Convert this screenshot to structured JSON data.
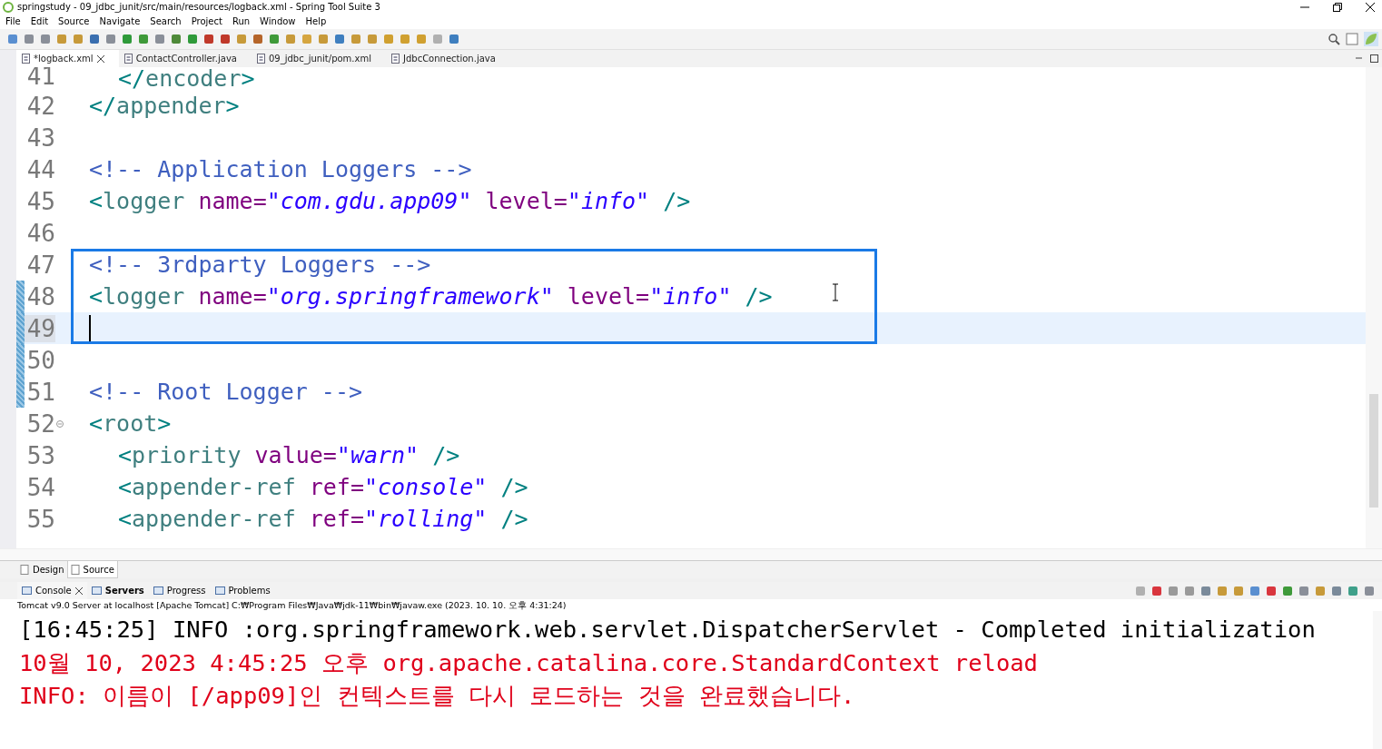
{
  "window": {
    "title": "springstudy - 09_jdbc_junit/src/main/resources/logback.xml - Spring Tool Suite 3"
  },
  "menu": [
    "File",
    "Edit",
    "Source",
    "Navigate",
    "Search",
    "Project",
    "Run",
    "Window",
    "Help"
  ],
  "editor_tabs": [
    {
      "label": "*logback.xml",
      "selected": true
    },
    {
      "label": "ContactController.java",
      "selected": false
    },
    {
      "label": "09_jdbc_junit/pom.xml",
      "selected": false
    },
    {
      "label": "JdbcConnection.java",
      "selected": false
    }
  ],
  "code_lines": [
    {
      "number": "41",
      "indented": true,
      "tokens": [
        {
          "kind": "punct",
          "text": "</"
        },
        {
          "kind": "tag",
          "text": "encoder"
        },
        {
          "kind": "punct",
          "text": ">"
        }
      ]
    },
    {
      "number": "42",
      "tokens": [
        {
          "kind": "punct",
          "text": "</"
        },
        {
          "kind": "tag",
          "text": "appender"
        },
        {
          "kind": "punct",
          "text": ">"
        }
      ]
    },
    {
      "number": "43"
    },
    {
      "number": "44",
      "tokens": [
        {
          "kind": "comment",
          "text": "<!-- Application Loggers -->"
        }
      ]
    },
    {
      "number": "45",
      "tokens": [
        {
          "kind": "punct",
          "text": "<"
        },
        {
          "kind": "tag",
          "text": "logger"
        },
        {
          "kind": "attr",
          "text": " name="
        },
        {
          "kind": "value",
          "text": "\"com.gdu.app09\""
        },
        {
          "kind": "attr",
          "text": " level="
        },
        {
          "kind": "value",
          "text": "\"info\""
        },
        {
          "kind": "punct",
          "text": " />"
        }
      ]
    },
    {
      "number": "46"
    },
    {
      "number": "47",
      "boxed": true,
      "tokens": [
        {
          "kind": "comment",
          "text": "<!-- 3rdparty Loggers -->"
        }
      ]
    },
    {
      "number": "48",
      "boxed": true,
      "changed": true,
      "tokens": [
        {
          "kind": "punct",
          "text": "<"
        },
        {
          "kind": "tag",
          "text": "logger"
        },
        {
          "kind": "attr",
          "text": " name="
        },
        {
          "kind": "value",
          "text": "\"org.springframework\""
        },
        {
          "kind": "attr",
          "text": " level="
        },
        {
          "kind": "value",
          "text": "\"info\""
        },
        {
          "kind": "punct",
          "text": " />"
        }
      ]
    },
    {
      "number": "49",
      "boxed": true,
      "current": true,
      "changed": true
    },
    {
      "number": "50",
      "changed": true
    },
    {
      "number": "51",
      "changed": true,
      "tokens": [
        {
          "kind": "comment",
          "text": "<!-- Root Logger -->"
        }
      ]
    },
    {
      "number": "52",
      "foldable": true,
      "tokens": [
        {
          "kind": "punct",
          "text": "<"
        },
        {
          "kind": "tag",
          "text": "root"
        },
        {
          "kind": "punct",
          "text": ">"
        }
      ]
    },
    {
      "number": "53",
      "indented": true,
      "tokens": [
        {
          "kind": "punct",
          "text": "<"
        },
        {
          "kind": "tag",
          "text": "priority"
        },
        {
          "kind": "attr",
          "text": " value="
        },
        {
          "kind": "value",
          "text": "\"warn\""
        },
        {
          "kind": "punct",
          "text": " />"
        }
      ]
    },
    {
      "number": "54",
      "indented": true,
      "tokens": [
        {
          "kind": "punct",
          "text": "<"
        },
        {
          "kind": "tag",
          "text": "appender-ref"
        },
        {
          "kind": "attr",
          "text": " ref="
        },
        {
          "kind": "value",
          "text": "\"console\""
        },
        {
          "kind": "punct",
          "text": " />"
        }
      ]
    },
    {
      "number": "55",
      "indented": true,
      "tokens": [
        {
          "kind": "punct",
          "text": "<"
        },
        {
          "kind": "tag",
          "text": "appender-ref"
        },
        {
          "kind": "attr",
          "text": " ref="
        },
        {
          "kind": "value",
          "text": "\"rolling\""
        },
        {
          "kind": "punct",
          "text": " />"
        }
      ]
    }
  ],
  "view_tabs": [
    {
      "label": "Design",
      "selected": false
    },
    {
      "label": "Source",
      "selected": true
    }
  ],
  "console_tabs": [
    {
      "label": "Console",
      "selected": true,
      "bold": false
    },
    {
      "label": "Servers",
      "selected": false,
      "bold": true
    },
    {
      "label": "Progress",
      "selected": false,
      "bold": false
    },
    {
      "label": "Problems",
      "selected": false,
      "bold": false
    }
  ],
  "console": {
    "header": "Tomcat v9.0 Server at localhost [Apache Tomcat] C:₩Program Files₩Java₩jdk-11₩bin₩javaw.exe  (2023. 10. 10. 오후 4:31:24)",
    "lines": [
      {
        "kind": "stdout",
        "text": "[16:45:25] INFO :org.springframework.web.servlet.DispatcherServlet - Completed initialization"
      },
      {
        "kind": "stderr",
        "text": "10월 10, 2023 4:45:25 오후 org.apache.catalina.core.StandardContext reload"
      },
      {
        "kind": "stderr",
        "text": "INFO: 이름이 [/app09]인 컨텍스트를 다시 로드하는 것을 완료했습니다."
      }
    ]
  }
}
